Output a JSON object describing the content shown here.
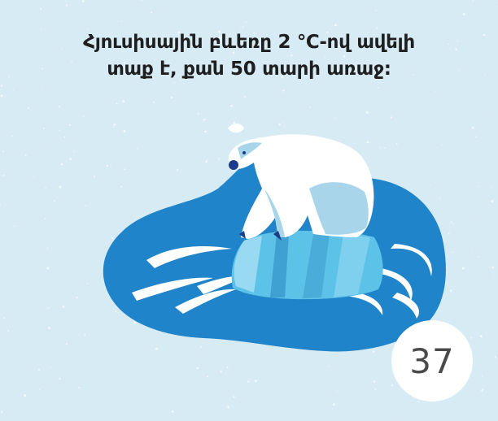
{
  "headline": {
    "line1": "Հյուսիսային բևեռը 2 ℃-ով ավելի",
    "line2": "տաք է, քան 50 տարի առաջ:"
  },
  "page_number": "37",
  "colors": {
    "background": "#d7ebf5",
    "water": "#1f84c9",
    "ice": "#5cc2e8",
    "bear_fur": "#ffffff",
    "bear_shadow": "#a9d5ea",
    "text": "#1f1f1f",
    "badge_text": "#4a4a4a"
  },
  "icons": [
    "polar-bear-icon",
    "ice-floe-icon",
    "water-puddle-icon"
  ]
}
